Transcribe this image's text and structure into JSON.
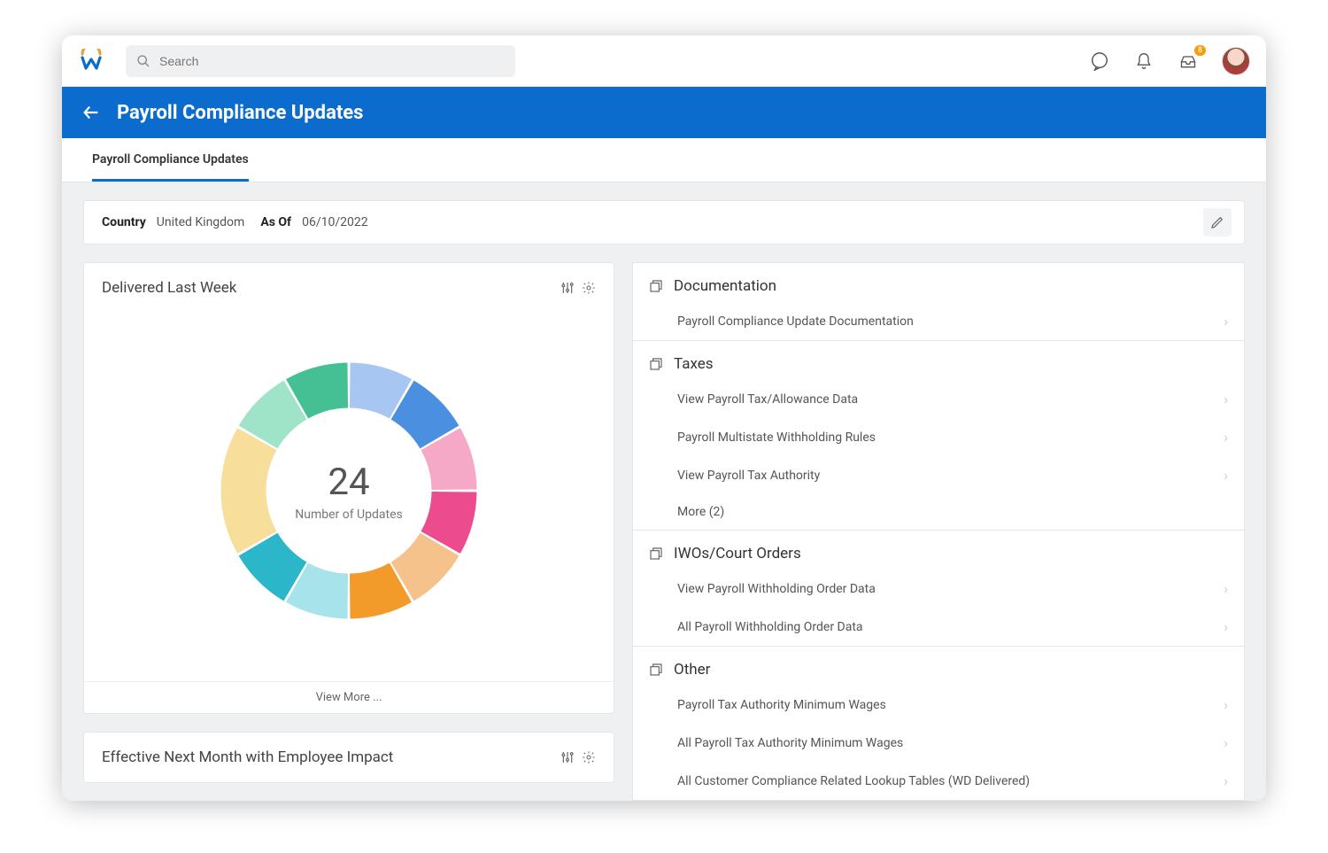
{
  "header": {
    "search_placeholder": "Search",
    "inbox_badge": "8"
  },
  "page": {
    "title": "Payroll Compliance Updates",
    "tab_label": "Payroll Compliance Updates"
  },
  "filter": {
    "country_label": "Country",
    "country_value": "United Kingdom",
    "asof_label": "As Of",
    "asof_value": "06/10/2022"
  },
  "cards": {
    "delivered": {
      "title": "Delivered Last Week",
      "center_value": "24",
      "center_label": "Number of Updates",
      "view_more": "View More ..."
    },
    "effective": {
      "title": "Effective Next Month with Employee Impact"
    }
  },
  "panels": {
    "documentation": {
      "title": "Documentation",
      "items": [
        "Payroll Compliance Update Documentation"
      ]
    },
    "taxes": {
      "title": "Taxes",
      "items": [
        "View Payroll Tax/Allowance Data",
        "Payroll Multistate Withholding Rules",
        "View Payroll Tax Authority",
        "More (2)"
      ]
    },
    "iwo": {
      "title": "IWOs/Court Orders",
      "items": [
        "View Payroll Withholding Order Data",
        "All Payroll Withholding Order Data"
      ]
    },
    "other": {
      "title": "Other",
      "items": [
        "Payroll Tax Authority Minimum Wages",
        "All Payroll Tax Authority Minimum Wages",
        "All Customer Compliance Related Lookup Tables (WD Delivered)"
      ]
    }
  },
  "chart_data": {
    "type": "pie",
    "title": "Delivered Last Week",
    "center_value": 24,
    "center_label": "Number of Updates",
    "series": [
      {
        "name": "slice-1",
        "value": 2,
        "color": "#9fe3c9"
      },
      {
        "name": "slice-2",
        "value": 2,
        "color": "#45bf94"
      },
      {
        "name": "slice-3",
        "value": 2,
        "color": "#a7c6f2"
      },
      {
        "name": "slice-4",
        "value": 2,
        "color": "#4a8fe0"
      },
      {
        "name": "slice-5",
        "value": 2,
        "color": "#f6a8c7"
      },
      {
        "name": "slice-6",
        "value": 2,
        "color": "#ec4b8d"
      },
      {
        "name": "slice-7",
        "value": 2,
        "color": "#f4c28a"
      },
      {
        "name": "slice-8",
        "value": 2,
        "color": "#f29b2a"
      },
      {
        "name": "slice-9",
        "value": 2,
        "color": "#a6e3ea"
      },
      {
        "name": "slice-10",
        "value": 2,
        "color": "#2cb6c9"
      },
      {
        "name": "slice-11",
        "value": 4,
        "color": "#f7df9b"
      }
    ]
  }
}
